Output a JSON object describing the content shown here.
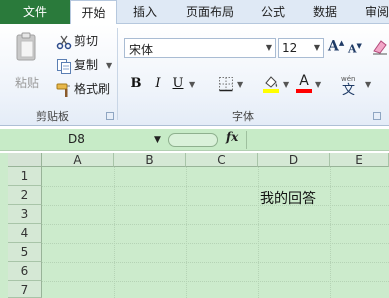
{
  "tabs": {
    "file": "文件",
    "home": "开始",
    "insert": "插入",
    "page_layout": "页面布局",
    "formulas": "公式",
    "data": "数据",
    "review": "审阅"
  },
  "clipboard": {
    "paste": "粘贴",
    "cut": "剪切",
    "copy": "复制",
    "format_painter": "格式刷",
    "group_label": "剪贴板"
  },
  "font": {
    "name": "宋体",
    "size": "12",
    "bold": "B",
    "italic": "I",
    "underline": "U",
    "font_color_glyph": "A",
    "group_label": "字体",
    "grow_glyph": "A",
    "shrink_glyph": "A"
  },
  "formula_bar": {
    "name_box": "D8",
    "fx": "fx"
  },
  "sheet": {
    "columns": [
      "A",
      "B",
      "C",
      "D",
      "E"
    ],
    "rows": [
      "1",
      "2",
      "3",
      "4",
      "5",
      "6",
      "7"
    ],
    "cell_d2": "我的回答"
  },
  "colors": {
    "file_tab": "#2a7a3b",
    "sheet_background": "#ccebcc",
    "font_color_indicator": "#ff0000",
    "fill_color_indicator": "#ffff00"
  }
}
